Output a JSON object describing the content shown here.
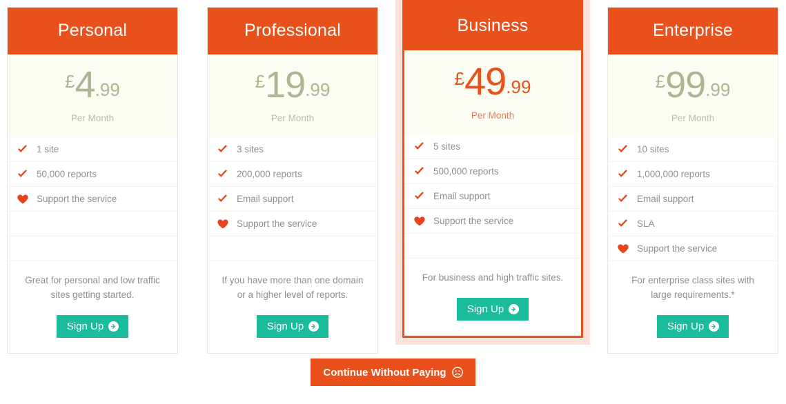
{
  "theme": {
    "header_orange": "#e8501c",
    "signup_teal": "#1abc9c",
    "price_muted": "#aeb592",
    "price_featured": "#e8501c",
    "price_bg": "#fbfcf2",
    "feature_text": "#8b8f93",
    "check_icon_color": "#e8431a"
  },
  "plans": [
    {
      "name": "Personal",
      "currency": "£",
      "price_major": "4",
      "price_minor": ".99",
      "period": "Per Month",
      "featured": false,
      "features": [
        {
          "icon": "check-icon",
          "label": "1 site"
        },
        {
          "icon": "check-icon",
          "label": "50,000 reports"
        },
        {
          "icon": "heart-icon",
          "label": "Support the service"
        },
        {
          "icon": "none",
          "label": ""
        },
        {
          "icon": "none",
          "label": ""
        }
      ],
      "description": "Great for personal and low traffic sites getting started.",
      "cta_label": "Sign Up",
      "cta_icon": "arrow-circle-right-icon"
    },
    {
      "name": "Professional",
      "currency": "£",
      "price_major": "19",
      "price_minor": ".99",
      "period": "Per Month",
      "featured": false,
      "features": [
        {
          "icon": "check-icon",
          "label": "3 sites"
        },
        {
          "icon": "check-icon",
          "label": "200,000 reports"
        },
        {
          "icon": "check-icon",
          "label": "Email support"
        },
        {
          "icon": "heart-icon",
          "label": "Support the service"
        },
        {
          "icon": "none",
          "label": ""
        }
      ],
      "description": "If you have more than one domain or a higher level of reports.",
      "cta_label": "Sign Up",
      "cta_icon": "arrow-circle-right-icon"
    },
    {
      "name": "Business",
      "currency": "£",
      "price_major": "49",
      "price_minor": ".99",
      "period": "Per Month",
      "featured": true,
      "features": [
        {
          "icon": "check-icon",
          "label": "5 sites"
        },
        {
          "icon": "check-icon",
          "label": "500,000 reports"
        },
        {
          "icon": "check-icon",
          "label": "Email support"
        },
        {
          "icon": "heart-icon",
          "label": "Support the service"
        },
        {
          "icon": "none",
          "label": ""
        }
      ],
      "description": "For business and high traffic sites.",
      "cta_label": "Sign Up",
      "cta_icon": "arrow-circle-right-icon"
    },
    {
      "name": "Enterprise",
      "currency": "£",
      "price_major": "99",
      "price_minor": ".99",
      "period": "Per Month",
      "featured": false,
      "features": [
        {
          "icon": "check-icon",
          "label": "10 sites"
        },
        {
          "icon": "check-icon",
          "label": "1,000,000 reports"
        },
        {
          "icon": "check-icon",
          "label": "Email support"
        },
        {
          "icon": "check-icon",
          "label": "SLA"
        },
        {
          "icon": "heart-icon",
          "label": "Support the service"
        }
      ],
      "description": "For enterprise class sites with large requirements.*",
      "cta_label": "Sign Up",
      "cta_icon": "arrow-circle-right-icon"
    }
  ],
  "continue": {
    "label": "Continue Without Paying",
    "icon": "frown-face-icon"
  }
}
